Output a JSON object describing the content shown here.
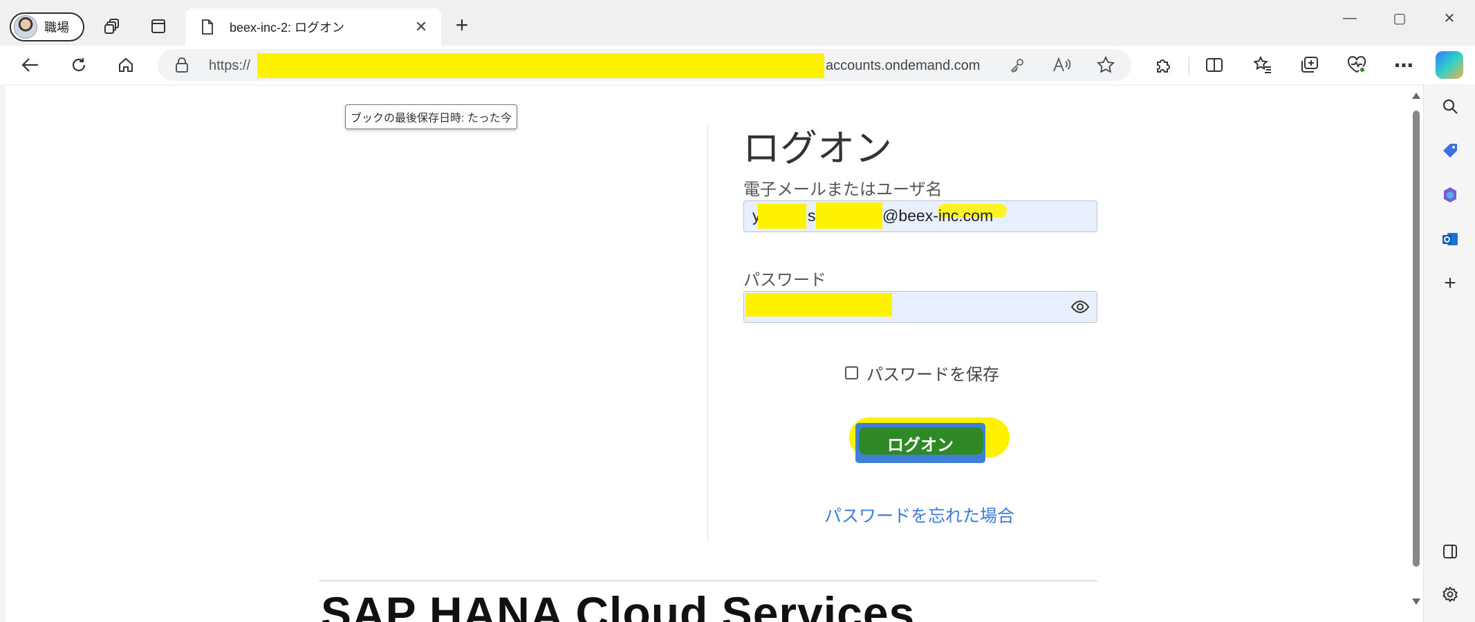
{
  "profile": {
    "label": "職場"
  },
  "tab": {
    "title": "beex-inc-2: ログオン",
    "close_glyph": "✕"
  },
  "newtab": {
    "glyph": "+"
  },
  "window_controls": {
    "minimize": "—",
    "maximize": "▢",
    "close": "✕"
  },
  "address": {
    "prefix": "https://",
    "domain": "accounts.ondemand.com"
  },
  "page": {
    "tooltip": "ブックの最後保存日時: たった今",
    "title": "ログオン",
    "email_label": "電子メールまたはユーザ名",
    "email_value_parts": [
      "y",
      "s",
      "@beex-inc.com"
    ],
    "password_label": "パスワード",
    "remember_label": "パスワードを保存",
    "remember_checked": false,
    "logon_button": "ログオン",
    "forgot_link": "パスワードを忘れた場合",
    "footer_title": "SAP HANA Cloud Services"
  },
  "colors": {
    "redaction": "#fff200",
    "button": "#3f7fd6",
    "link": "#3d7bd8",
    "field_bg": "#e8f0fe"
  }
}
